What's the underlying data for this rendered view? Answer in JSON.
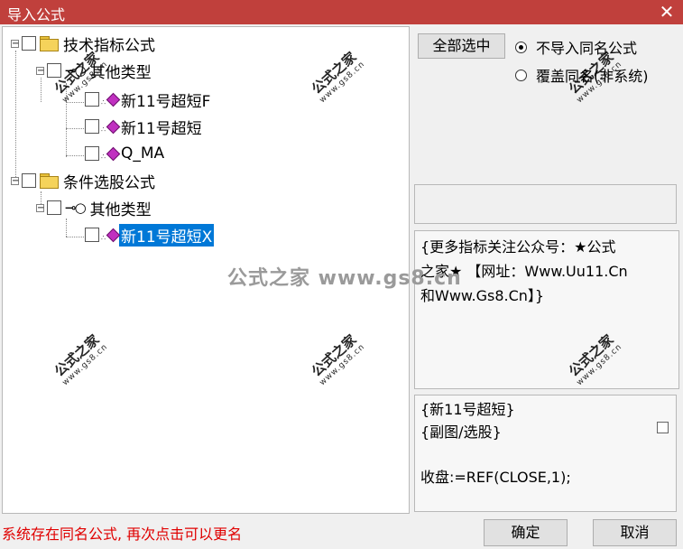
{
  "window": {
    "title": "导入公式",
    "close_glyph": "✕"
  },
  "tree": {
    "nodes": [
      {
        "id": "group1",
        "label": "技术指标公式"
      },
      {
        "id": "group1_sub",
        "label": "其他类型"
      },
      {
        "id": "item1",
        "label": "新11号超短F"
      },
      {
        "id": "item2",
        "label": "新11号超短"
      },
      {
        "id": "item3",
        "label": "Q_MA"
      },
      {
        "id": "group2",
        "label": "条件选股公式"
      },
      {
        "id": "group2_sub",
        "label": "其他类型"
      },
      {
        "id": "item4",
        "label": "新11号超短X",
        "selected": true
      }
    ],
    "expand_glyph": "−"
  },
  "controls": {
    "select_all": "全部选中",
    "radio_skip": "不导入同名公式",
    "radio_overwrite": "覆盖同名(非系统)",
    "selected_option": "radio_skip"
  },
  "description": {
    "line1": "{更多指标关注公众号：★公式",
    "line2": "之家★ 【网址：Www.Uu11.Cn",
    "line3": "和Www.Gs8.Cn】}"
  },
  "code": {
    "line1": "{新11号超短}",
    "line2": "{副图/选股}",
    "line3": "",
    "line4": "收盘:=REF(CLOSE,1);"
  },
  "footer": {
    "status": "系统存在同名公式, 再次点击可以更名",
    "ok": "确定",
    "cancel": "取消"
  },
  "watermark": {
    "brand": "公式之家",
    "site": "www.gs8.cn",
    "banner": "公式之家 www.gs8.cn"
  },
  "colors": {
    "titlebar": "#c0403c",
    "selection": "#0078d7",
    "status": "#e00000"
  }
}
